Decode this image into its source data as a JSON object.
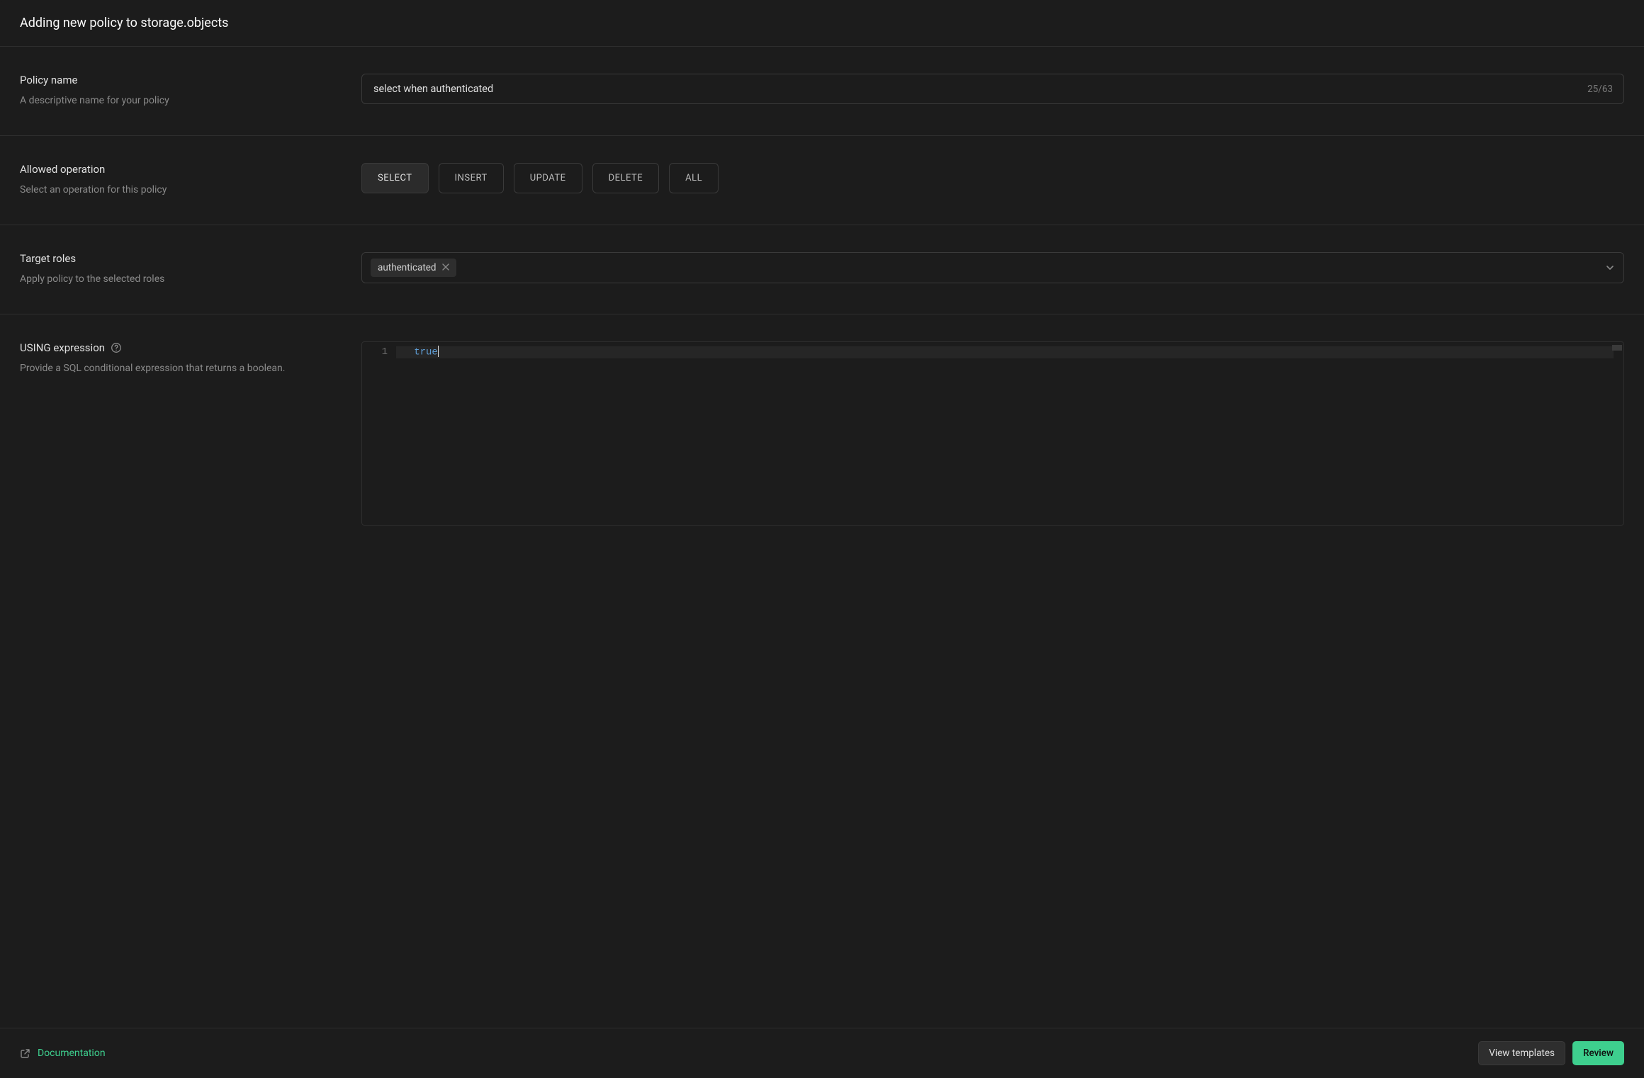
{
  "header": {
    "title": "Adding new policy to storage.objects"
  },
  "policy_name": {
    "label": "Policy name",
    "desc": "A descriptive name for your policy",
    "value": "select when authenticated",
    "char_count": "25/63"
  },
  "allowed_operation": {
    "label": "Allowed operation",
    "desc": "Select an operation for this policy",
    "options": {
      "select": "SELECT",
      "insert": "INSERT",
      "update": "UPDATE",
      "delete": "DELETE",
      "all": "ALL"
    },
    "selected": "SELECT"
  },
  "target_roles": {
    "label": "Target roles",
    "desc": "Apply policy to the selected roles",
    "chip": "authenticated"
  },
  "using_expression": {
    "label": "USING expression",
    "desc": "Provide a SQL conditional expression that returns a boolean.",
    "line_number": "1",
    "code": "true"
  },
  "footer": {
    "documentation": "Documentation",
    "view_templates": "View templates",
    "review": "Review"
  }
}
